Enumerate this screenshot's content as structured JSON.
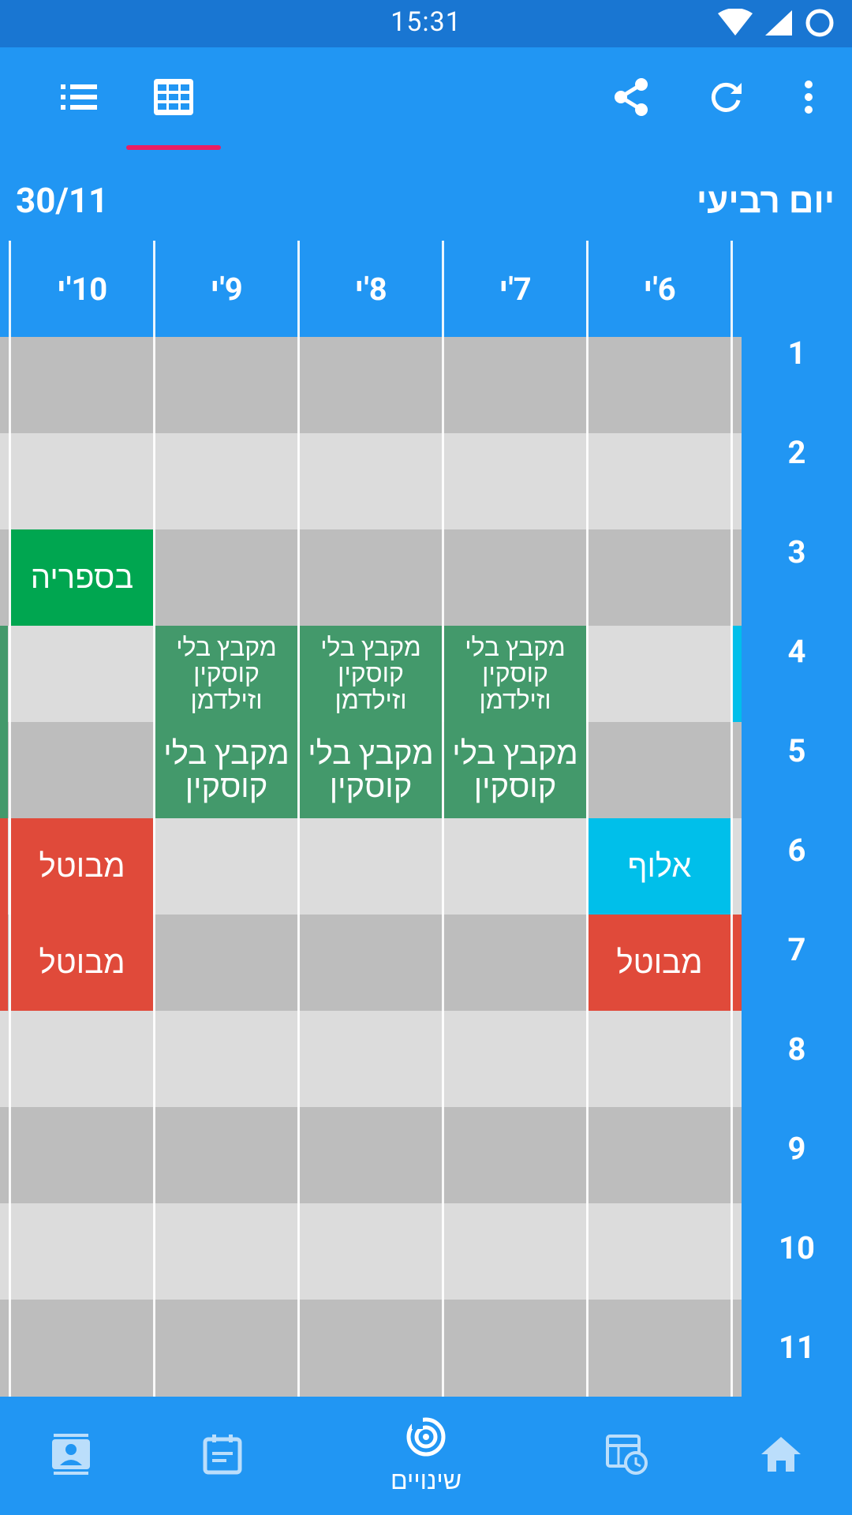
{
  "status_bar": {
    "time": "15:31"
  },
  "toolbar": {
    "list_view_icon": "list-icon",
    "grid_view_icon": "grid-icon",
    "share_icon": "share-icon",
    "refresh_icon": "refresh-icon",
    "menu_icon": "more-vert-icon"
  },
  "date_header": {
    "date": "30/11",
    "day": "יום רביעי"
  },
  "classes": [
    "10'י",
    "9'י",
    "8'י",
    "7'י",
    "6'י"
  ],
  "periods": [
    "1",
    "2",
    "3",
    "4",
    "5",
    "6",
    "7",
    "8",
    "9",
    "10",
    "11"
  ],
  "cells": {
    "c10_p3": "בספריה",
    "c9_p4": "מקבץ בלי קוסקין וזילדמן",
    "c9_p5": "מקבץ בלי קוסקין",
    "c8_p4": "מקבץ בלי קוסקין וזילדמן",
    "c8_p5": "מקבץ בלי קוסקין",
    "c7_p4": "מקבץ בלי קוסקין וזילדמן",
    "c7_p5": "מקבץ בלי קוסקין",
    "c10_p6": "מבוטל",
    "c10_p7": "מבוטל",
    "c6_p6": "אלוף",
    "c6_p7": "מבוטל"
  },
  "bottom_nav": {
    "active_label": "שינויים",
    "items": [
      "contacts-icon",
      "calendar-icon",
      "changes-icon",
      "schedule-icon",
      "home-icon"
    ]
  },
  "colors": {
    "primary": "#2196F3",
    "status_bar": "#1976D2",
    "accent": "#E91E63",
    "green": "#43996B",
    "library_green": "#00A650",
    "cancel_red": "#E04A3A",
    "cyan": "#00BFEA"
  }
}
